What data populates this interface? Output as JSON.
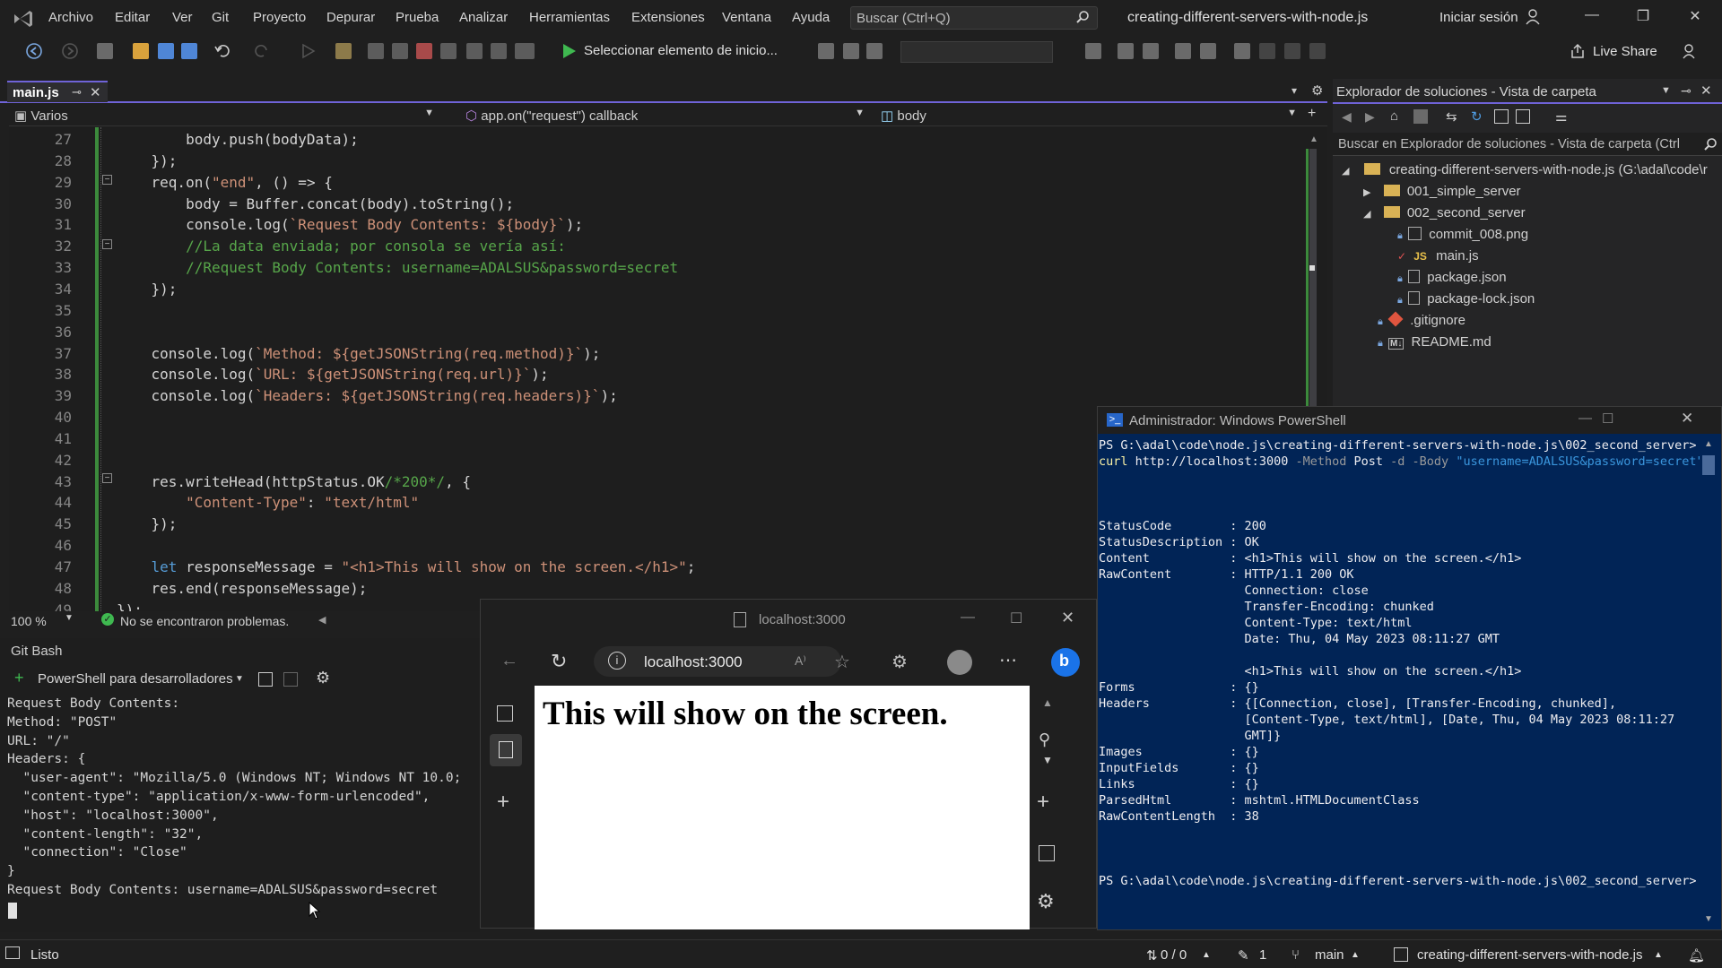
{
  "menu": {
    "items": [
      "Archivo",
      "Editar",
      "Ver",
      "Git",
      "Proyecto",
      "Depurar",
      "Prueba",
      "Analizar",
      "Herramientas",
      "Extensiones",
      "Ventana",
      "Ayuda"
    ],
    "search_placeholder": "Buscar (Ctrl+Q)",
    "window_title": "creating-different-servers-with-node.js",
    "signin": "Iniciar sesión"
  },
  "toolbar": {
    "run_label": "Seleccionar elemento de inicio...",
    "live_share": "Live Share"
  },
  "editor": {
    "tab_label": "main.js",
    "nav_scope": "Varios",
    "nav_member": "app.on(\"request\") callback",
    "nav_symbol": "body",
    "zoom": "100 %",
    "problems": "No se encontraron problemas.",
    "lines": [
      {
        "n": "27",
        "code": "        body.push(bodyData);"
      },
      {
        "n": "28",
        "code": "    });"
      },
      {
        "n": "29",
        "code": "    req.on(\"end\", () => {"
      },
      {
        "n": "30",
        "code": "        body = Buffer.concat(body).toString();"
      },
      {
        "n": "31",
        "code": "        console.log(`Request Body Contents: ${body}`);"
      },
      {
        "n": "32",
        "code": "        //La data enviada; por consola se vería así:"
      },
      {
        "n": "33",
        "code": "        //Request Body Contents: username=ADALSUS&password=secret"
      },
      {
        "n": "34",
        "code": "    });"
      },
      {
        "n": "35",
        "code": ""
      },
      {
        "n": "36",
        "code": ""
      },
      {
        "n": "37",
        "code": "    console.log(`Method: ${getJSONString(req.method)}`);"
      },
      {
        "n": "38",
        "code": "    console.log(`URL: ${getJSONString(req.url)}`);"
      },
      {
        "n": "39",
        "code": "    console.log(`Headers: ${getJSONString(req.headers)}`);"
      },
      {
        "n": "40",
        "code": ""
      },
      {
        "n": "41",
        "code": ""
      },
      {
        "n": "42",
        "code": ""
      },
      {
        "n": "43",
        "code": "    res.writeHead(httpStatus.OK/*200*/, {"
      },
      {
        "n": "44",
        "code": "        \"Content-Type\": \"text/html\""
      },
      {
        "n": "45",
        "code": "    });"
      },
      {
        "n": "46",
        "code": ""
      },
      {
        "n": "47",
        "code": "    let responseMessage = \"<h1>This will show on the screen.</h1>\";"
      },
      {
        "n": "48",
        "code": "    res.end(responseMessage);"
      },
      {
        "n": "49",
        "code": "});"
      }
    ]
  },
  "solution_explorer": {
    "title": "Explorador de soluciones - Vista de carpeta",
    "search_placeholder": "Buscar en Explorador de soluciones - Vista de carpeta (Ctrl",
    "root": "creating-different-servers-with-node.js (G:\\adal\\code\\r",
    "items": [
      {
        "label": "001_simple_server",
        "kind": "folder"
      },
      {
        "label": "002_second_server",
        "kind": "folder"
      },
      {
        "label": "commit_008.png",
        "kind": "file"
      },
      {
        "label": "main.js",
        "kind": "js"
      },
      {
        "label": "package.json",
        "kind": "file"
      },
      {
        "label": "package-lock.json",
        "kind": "file"
      },
      {
        "label": ".gitignore",
        "kind": "git"
      },
      {
        "label": "README.md",
        "kind": "md"
      }
    ]
  },
  "git_panel": {
    "title": "Git Bash",
    "shell": "PowerShell para desarrolladores",
    "output": [
      "Request Body Contents:",
      "Method: \"POST\"",
      "URL: \"/\"",
      "Headers: {",
      "  \"user-agent\": \"Mozilla/5.0 (Windows NT; Windows NT 10.0;",
      "  \"content-type\": \"application/x-www-form-urlencoded\",",
      "  \"host\": \"localhost:3000\",",
      "  \"content-length\": \"32\",",
      "  \"connection\": \"Close\"",
      "}",
      "Request Body Contents: username=ADALSUS&password=secret"
    ]
  },
  "browser": {
    "window_title": "localhost:3000",
    "url": "localhost:3000",
    "heading": "This will show on the screen."
  },
  "powershell": {
    "title": "Administrador: Windows PowerShell",
    "lines": [
      "PS G:\\adal\\code\\node.js\\creating-different-servers-with-node.js\\002_second_server>",
      "curl http://localhost:3000 -Method Post -d -Body \"username=ADALSUS&password=secret\"",
      "",
      "",
      "",
      "StatusCode        : 200",
      "StatusDescription : OK",
      "Content           : <h1>This will show on the screen.</h1>",
      "RawContent        : HTTP/1.1 200 OK",
      "                    Connection: close",
      "                    Transfer-Encoding: chunked",
      "                    Content-Type: text/html",
      "                    Date: Thu, 04 May 2023 08:11:27 GMT",
      "",
      "                    <h1>This will show on the screen.</h1>",
      "Forms             : {}",
      "Headers           : {[Connection, close], [Transfer-Encoding, chunked],",
      "                    [Content-Type, text/html], [Date, Thu, 04 May 2023 08:11:27",
      "                    GMT]}",
      "Images            : {}",
      "InputFields       : {}",
      "Links             : {}",
      "ParsedHtml        : mshtml.HTMLDocumentClass",
      "RawContentLength  : 38",
      "",
      "",
      "",
      "PS G:\\adal\\code\\node.js\\creating-different-servers-with-node.js\\002_second_server>"
    ]
  },
  "statusbar": {
    "ready": "Listo",
    "changes": "0 / 0",
    "edits": "1",
    "branch": "main",
    "repo": "creating-different-servers-with-node.js"
  },
  "colors": {
    "accent": "#6f63d8",
    "powershell_bg": "#012456",
    "keyword": "#569cd6",
    "string": "#ce9178",
    "comment": "#57a64a"
  }
}
